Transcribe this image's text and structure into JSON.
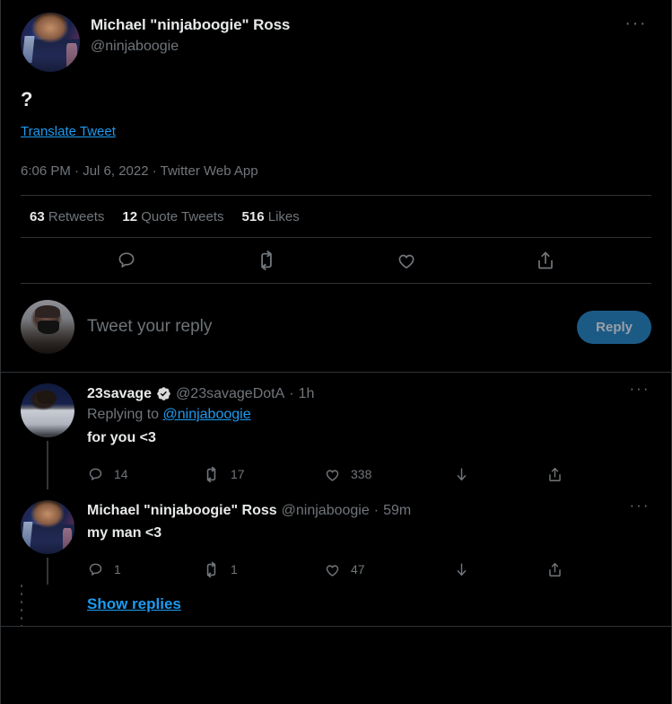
{
  "theme": {
    "background": "#000000",
    "text_primary": "#e7e9ea",
    "text_secondary": "#71767b",
    "accent_link": "#1d9bf0",
    "divider": "#2f3336",
    "reply_button_bg": "#1c5a86",
    "reply_button_text": "#9aa0a6"
  },
  "main_tweet": {
    "author": {
      "display_name": "Michael \"ninjaboogie\" Ross",
      "handle": "@ninjaboogie",
      "avatar_alt": "ninjaboogie-avatar"
    },
    "more_label": "···",
    "body_text": "?",
    "translate_label": "Translate Tweet",
    "timestamp": "6:06 PM · Jul 6, 2022 · Twitter Web App",
    "stats": [
      {
        "count": "63",
        "label": "Retweets"
      },
      {
        "count": "12",
        "label": "Quote Tweets"
      },
      {
        "count": "516",
        "label": "Likes"
      }
    ],
    "actions": [
      {
        "icon": "reply-icon",
        "name": "reply"
      },
      {
        "icon": "retweet-icon",
        "name": "retweet"
      },
      {
        "icon": "like-icon",
        "name": "like"
      },
      {
        "icon": "share-icon",
        "name": "share"
      }
    ]
  },
  "composer": {
    "placeholder": "Tweet your reply",
    "reply_button_label": "Reply",
    "avatar_alt": "current-user-avatar"
  },
  "replies": [
    {
      "display_name": "23savage",
      "verified": true,
      "handle": "@23savageDotA",
      "time": "1h",
      "separator": "·",
      "replying_to_prefix": "Replying to ",
      "replying_to_handle": "@ninjaboogie",
      "text": "for you <3",
      "more_label": "···",
      "avatar_alt": "23savage-avatar",
      "actions": {
        "replies": "14",
        "retweets": "17",
        "likes": "338",
        "download": "",
        "share": ""
      }
    },
    {
      "display_name": "Michael \"ninjaboogie\" Ross",
      "verified": false,
      "handle": "@ninjaboogie",
      "time": "59m",
      "separator": "·",
      "replying_to_prefix": "",
      "replying_to_handle": "",
      "text": "my man <3",
      "more_label": "···",
      "avatar_alt": "ninjaboogie-avatar",
      "actions": {
        "replies": "1",
        "retweets": "1",
        "likes": "47",
        "download": "",
        "share": ""
      }
    }
  ],
  "show_replies_label": "Show replies"
}
